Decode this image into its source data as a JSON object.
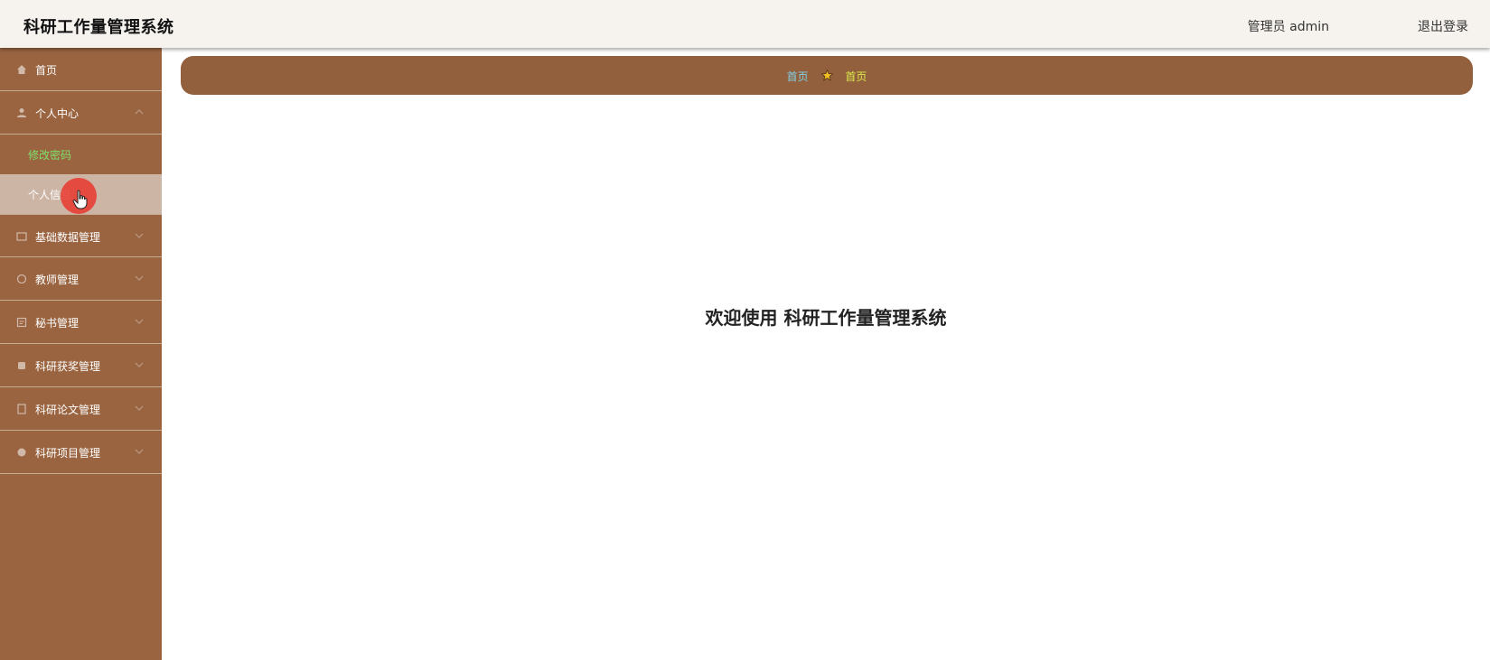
{
  "header": {
    "title": "科研工作量管理系统",
    "role_label": "管理员 admin",
    "logout_label": "退出登录"
  },
  "sidebar": {
    "items": [
      {
        "label": "首页",
        "icon": "home-icon"
      },
      {
        "label": "个人中心",
        "icon": "user-icon"
      },
      {
        "label": "基础数据管理",
        "icon": "data-icon"
      },
      {
        "label": "教师管理",
        "icon": "teacher-icon"
      },
      {
        "label": "秘书管理",
        "icon": "secretary-icon"
      },
      {
        "label": "科研获奖管理",
        "icon": "award-icon"
      },
      {
        "label": "科研论文管理",
        "icon": "paper-icon"
      },
      {
        "label": "科研项目管理",
        "icon": "project-icon"
      }
    ],
    "submenu": [
      {
        "label": "修改密码"
      },
      {
        "label": "个人信息"
      }
    ]
  },
  "breadcrumb": {
    "home": "首页",
    "current": "首页"
  },
  "main": {
    "welcome": "欢迎使用 科研工作量管理系统"
  },
  "colors": {
    "sidebar_bg": "#9a6441",
    "breadcrumb_bg": "#93603d",
    "header_bg": "#f6f3ee",
    "submenu_active_bg": "#cdb5a6",
    "submenu_green": "#7ee06a"
  }
}
